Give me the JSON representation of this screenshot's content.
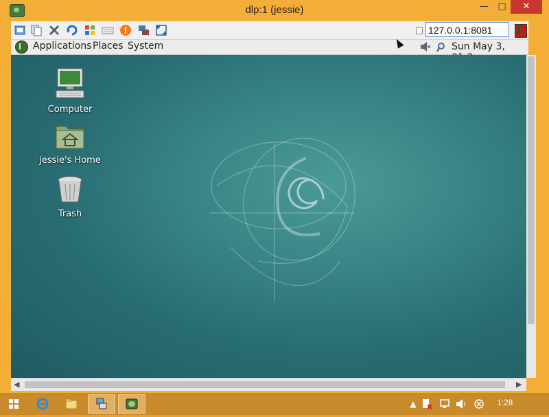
{
  "window": {
    "title": "dlp:1 (jessie)",
    "minimize": "—",
    "maximize": "□",
    "close": "✕"
  },
  "vnc_toolbar": {
    "icons": [
      "options-icon",
      "clipboard-icon",
      "tools-icon",
      "refresh-icon",
      "windows-key-icon",
      "keyboard-icon",
      "alert-icon",
      "disconnect-icon",
      "fullscreen-icon"
    ],
    "address": "127.0.0.1:8081"
  },
  "gnome_panel": {
    "menus": [
      "Applications",
      "Places",
      "System"
    ],
    "clock": "Sun May  3, 01:2"
  },
  "desktop": {
    "icons": [
      {
        "label": "Computer",
        "icon": "computer-icon"
      },
      {
        "label": "jessie's Home",
        "icon": "home-folder-icon"
      },
      {
        "label": "Trash",
        "icon": "trash-icon"
      }
    ],
    "accent": "#2f7b7d"
  },
  "taskbar": {
    "buttons": [
      "start-icon",
      "ie-icon",
      "explorer-icon",
      "network-app-icon",
      "vnc-app-icon"
    ],
    "clock": "1:28",
    "tray_up": "▲"
  },
  "colors": {
    "frame": "#f3ae37",
    "taskbar": "#c88a2b",
    "close": "#c7372f"
  }
}
